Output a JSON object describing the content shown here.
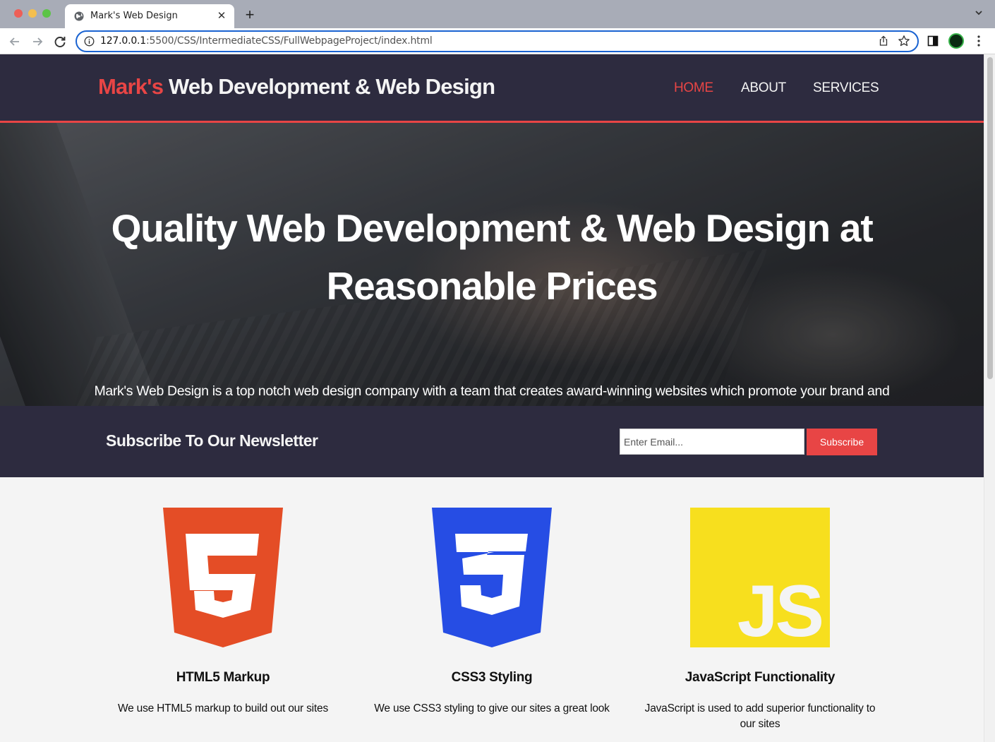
{
  "browser": {
    "tab_title": "Mark's Web Design",
    "tab_close": "✕",
    "new_tab": "+",
    "url_host": "127.0.0.1",
    "url_rest": ":5500/CSS/IntermediateCSS/FullWebpageProject/index.html"
  },
  "header": {
    "brand_highlight": "Mark's",
    "brand_rest": " Web Development & Web Design",
    "nav": [
      {
        "label": "HOME",
        "active": true
      },
      {
        "label": "ABOUT",
        "active": false
      },
      {
        "label": "SERVICES",
        "active": false
      }
    ]
  },
  "showcase": {
    "title": "Quality Web Development & Web Design at Reasonable Prices",
    "text": "Mark's Web Design is a top notch web design company with a team that creates award-winning websites which promote your brand and increase your revenue to help grow and improve your business."
  },
  "newsletter": {
    "title": "Subscribe To Our Newsletter",
    "email_placeholder": "Enter Email...",
    "button_label": "Subscribe"
  },
  "boxes": [
    {
      "icon": "html5-logo",
      "title": "HTML5 Markup",
      "text": "We use HTML5 markup to build out our sites"
    },
    {
      "icon": "css3-logo",
      "title": "CSS3 Styling",
      "text": "We use CSS3 styling to give our sites a great look"
    },
    {
      "icon": "javascript-logo",
      "logo_text": "JS",
      "title": "JavaScript Functionality",
      "text": "JavaScript is used to add superior functionality to our sites"
    }
  ],
  "colors": {
    "accent": "#e84545",
    "dark": "#2d2b3f",
    "light": "#f4f4f4",
    "html5": "#e44d26",
    "css3": "#264de4",
    "javascript": "#f7df1e"
  }
}
